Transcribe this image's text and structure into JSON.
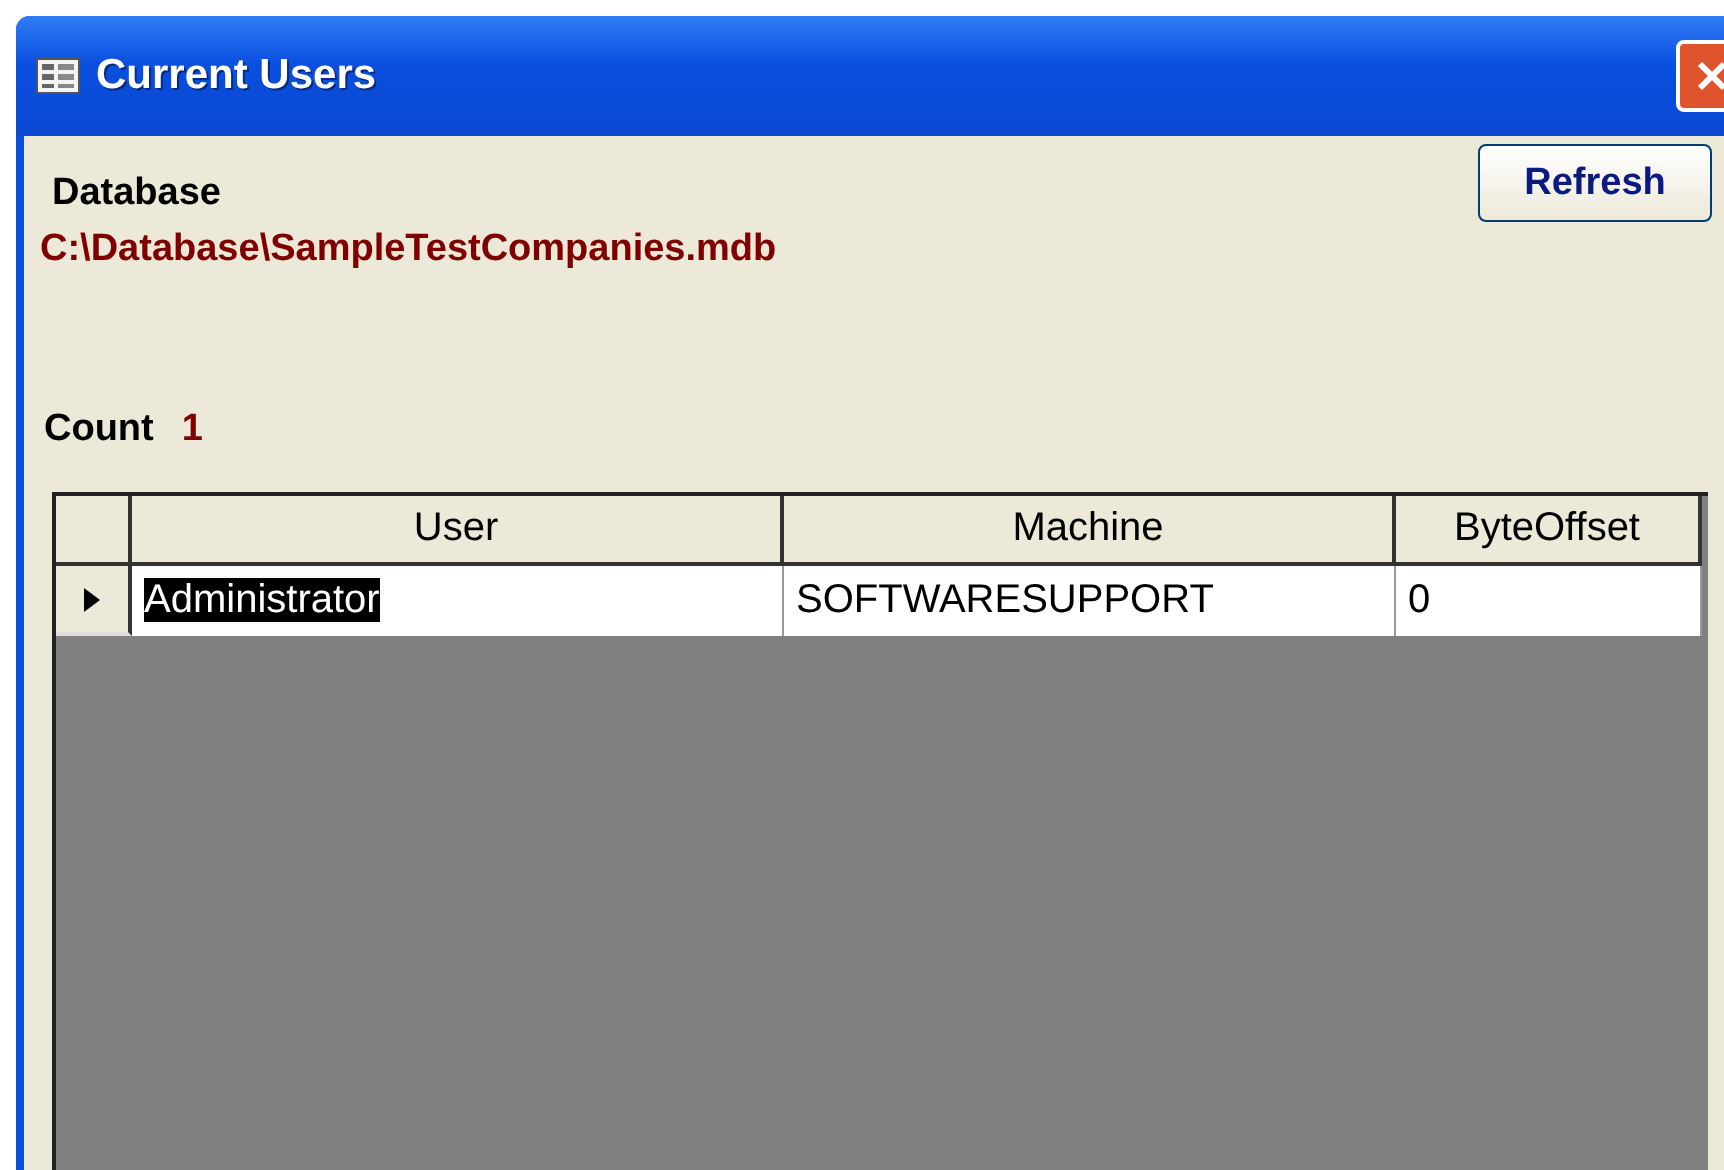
{
  "window": {
    "title": "Current Users"
  },
  "refresh_button": {
    "label": "Refresh"
  },
  "database": {
    "label": "Database",
    "path": "C:\\Database\\SampleTestCompanies.mdb"
  },
  "count": {
    "label": "Count",
    "value": "1"
  },
  "table": {
    "columns": [
      "User",
      "Machine",
      "ByteOffset"
    ],
    "rows": [
      {
        "cells": [
          "Administrator",
          "SOFTWARESUPPORT",
          "0"
        ],
        "current": true
      }
    ]
  }
}
